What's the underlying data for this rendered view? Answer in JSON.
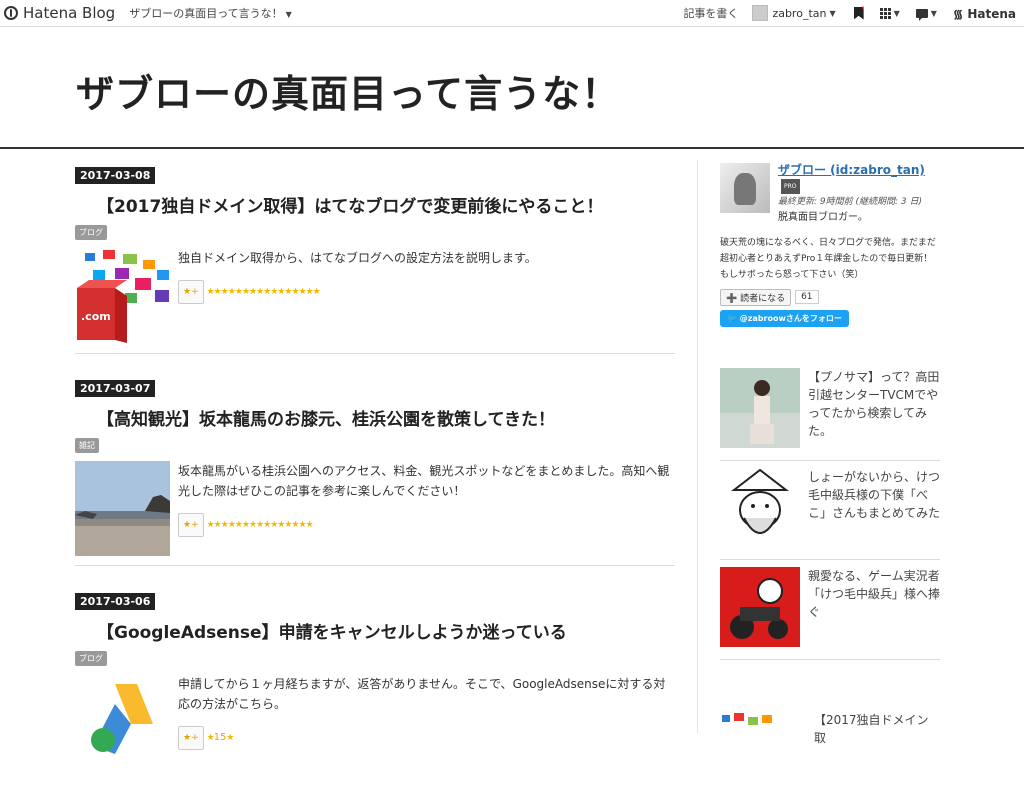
{
  "topbar": {
    "logo": "Hatena Blog",
    "blog_name": "ザブローの真面目って言うな！",
    "write": "記事を書く",
    "user": "zabro_tan",
    "hatena": "Hatena"
  },
  "header": {
    "title": "ザブローの真面目って言うな！"
  },
  "entries": [
    {
      "date": "2017-03-08",
      "title": "【2017独自ドメイン取得】はてなブログで変更前後にやること！",
      "category": "ブログ",
      "summary": "独自ドメイン取得から、はてなブログへの設定方法を説明します。",
      "star_count": ""
    },
    {
      "date": "2017-03-07",
      "title": "【高知観光】坂本龍馬のお膝元、桂浜公園を散策してきた！",
      "category": "雑記",
      "summary": "坂本龍馬がいる桂浜公園へのアクセス、料金、観光スポットなどをまとめました。高知へ観光した際はぜひこの記事を参考に楽しんでください！",
      "star_count": ""
    },
    {
      "date": "2017-03-06",
      "title": "【GoogleAdsense】申請をキャンセルしようか迷っている",
      "category": "ブログ",
      "summary": "申請してから１ヶ月経ちますが、返答がありません。そこで、GoogleAdsenseに対する対応の方法がこちら。",
      "star_count": "15"
    }
  ],
  "addstar": "★+",
  "sidebar": {
    "profile": {
      "name": "ザブロー (id:zabro_tan)",
      "badge": "PRO",
      "updated": "最終更新: 9時間前 (継続期間: 3 日)",
      "tagline": "脱真面目ブロガー。",
      "description": "破天荒の塊になるべく、日々ブログで発信。まだまだ超初心者とりあえずPro１年課金したので毎日更新！もしサボったら怒って下さい（笑）",
      "subscribe": "➕ 読者になる",
      "subscribers": "61",
      "twitter": "@zabroowさんをフォロー"
    },
    "items": [
      {
        "text": "【プノサマ】って？高田引越センターTVCMでやってたから検索してみた。"
      },
      {
        "text": "しょーがないから、けつ毛中級兵様の下僕「べこ」さんもまとめてみた"
      },
      {
        "text": "親愛なる、ゲーム実況者「けつ毛中級兵」様へ捧ぐ"
      },
      {
        "text": "【2017独自ドメイン取"
      }
    ]
  }
}
